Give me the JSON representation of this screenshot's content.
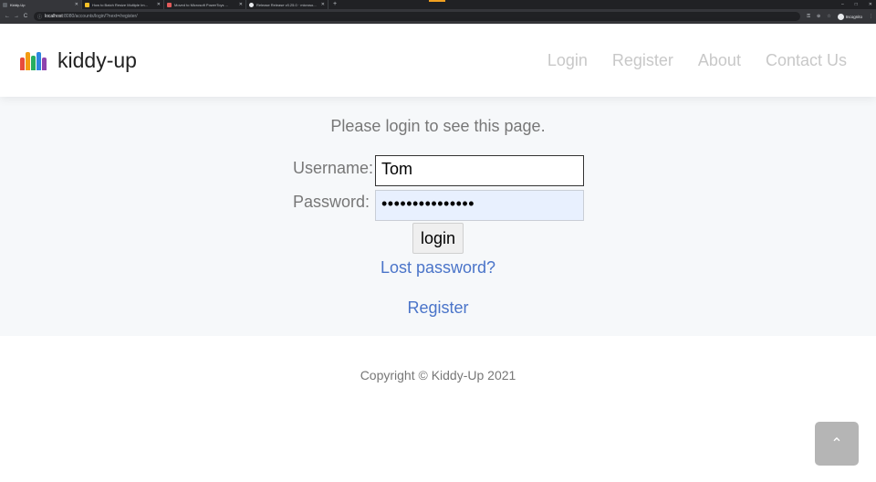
{
  "browser": {
    "tabs": [
      {
        "title": "Kiddy-Up",
        "fav_color": "#5f6368",
        "active": true
      },
      {
        "title": "How to Batch Resize Multiple Im...",
        "fav_color": "#f6c026",
        "active": false
      },
      {
        "title": "Moved to Microsoft PowerToys ...",
        "fav_color": "#e25b5b",
        "active": false
      },
      {
        "title": "Release Release v0.25.0 · microso...",
        "fav_color": "#e8eaed",
        "active": false
      }
    ],
    "new_tab": "+",
    "window_controls": [
      "–",
      "□",
      "✕"
    ],
    "nav_back": "←",
    "nav_forward": "→",
    "nav_reload": "C",
    "info_icon": "ⓘ",
    "url_host": "localhost",
    "url_path": ":8080/accounts/login/?next=/register/",
    "key_icon": "⚿",
    "zoom_icon": "⊕",
    "star_icon": "☆",
    "incognito_label": "Incognito",
    "menu_icon": "⋮"
  },
  "header": {
    "brand_name": "kiddy-up",
    "logo_colors": [
      "#e74c3c",
      "#f39c12",
      "#27ae60",
      "#2e86de",
      "#8e44ad"
    ],
    "nav": [
      "Login",
      "Register",
      "About",
      "Contact Us"
    ]
  },
  "main": {
    "message": "Please login to see this page.",
    "username_label": "Username:",
    "username_value": "Tom",
    "password_label": "Password:",
    "password_value": "•••••••••••••••",
    "login_label": "login",
    "lost_password": "Lost password?",
    "register": "Register"
  },
  "footer": {
    "copyright": "Copyright © Kiddy-Up 2021",
    "to_top_icon": "⌃"
  }
}
